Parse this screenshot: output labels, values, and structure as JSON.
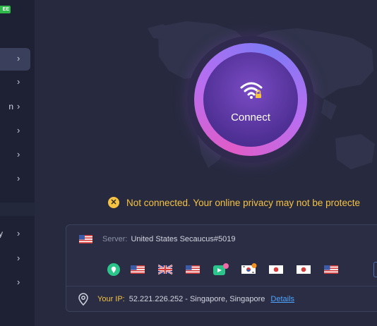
{
  "sidebar": {
    "badge": "EE",
    "items": [
      {
        "label": "",
        "active": true
      },
      {
        "label": "",
        "active": false
      },
      {
        "label": "n",
        "active": false
      },
      {
        "label": "",
        "active": false
      },
      {
        "label": "",
        "active": false
      },
      {
        "label": "",
        "active": false
      },
      {
        "label": "ty",
        "active": false
      },
      {
        "label": "",
        "active": false
      },
      {
        "label": "",
        "active": false
      }
    ],
    "chevron": "›"
  },
  "connect": {
    "label": "Connect",
    "icon": "wifi-lock-icon"
  },
  "status": {
    "icon": "warning-x-icon",
    "text": "Not connected. Your online privacy may not be protecte"
  },
  "server": {
    "label": "Server:",
    "value": "United States Secaucus#5019",
    "flag": "us-flag-icon"
  },
  "locations": [
    {
      "icon": "location-pin-icon"
    },
    {
      "icon": "us-flag-icon"
    },
    {
      "icon": "uk-flag-icon"
    },
    {
      "icon": "us-flag-icon"
    },
    {
      "icon": "streaming-badge-icon"
    },
    {
      "icon": "kr-flag-icon"
    },
    {
      "icon": "jp-flag-icon"
    },
    {
      "icon": "jp-flag-icon"
    },
    {
      "icon": "us-flag-icon"
    }
  ],
  "ip": {
    "icon": "location-pin-outline-icon",
    "label": "Your IP:",
    "value": "52.221.226.252 - Singapore, Singapore",
    "details": "Details"
  },
  "colors": {
    "background": "#272a3f",
    "sidebar": "#1e2134",
    "warning": "#f5c242",
    "link": "#4ea4ff",
    "free_badge": "#2fb74b"
  }
}
